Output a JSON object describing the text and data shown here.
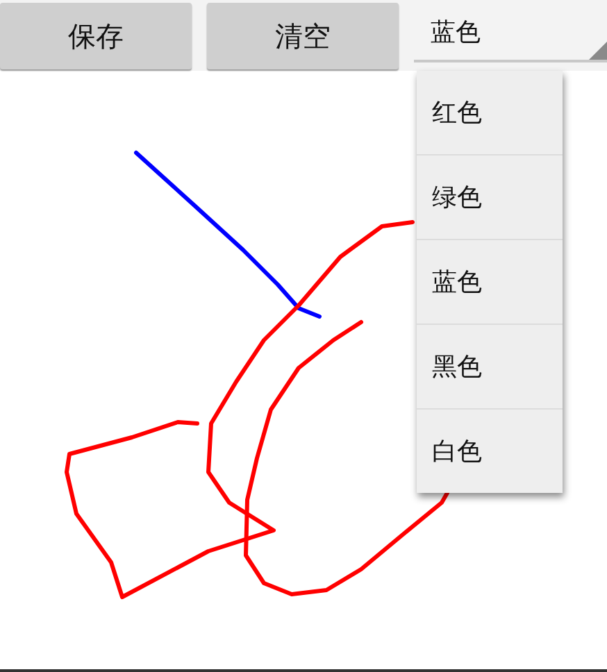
{
  "toolbar": {
    "buttons": [
      {
        "label": "保存"
      },
      {
        "label": "清空"
      }
    ],
    "color_picker": {
      "value": "蓝色"
    }
  },
  "canvas": {
    "strokes": [
      {
        "color": "#0000ff"
      },
      {
        "color": "#ff0000"
      },
      {
        "color": "#ff0000"
      }
    ]
  },
  "dropdown": {
    "items": [
      {
        "label": "红色"
      },
      {
        "label": "绿色"
      },
      {
        "label": "蓝色"
      },
      {
        "label": "黑色"
      },
      {
        "label": "白色"
      }
    ]
  }
}
